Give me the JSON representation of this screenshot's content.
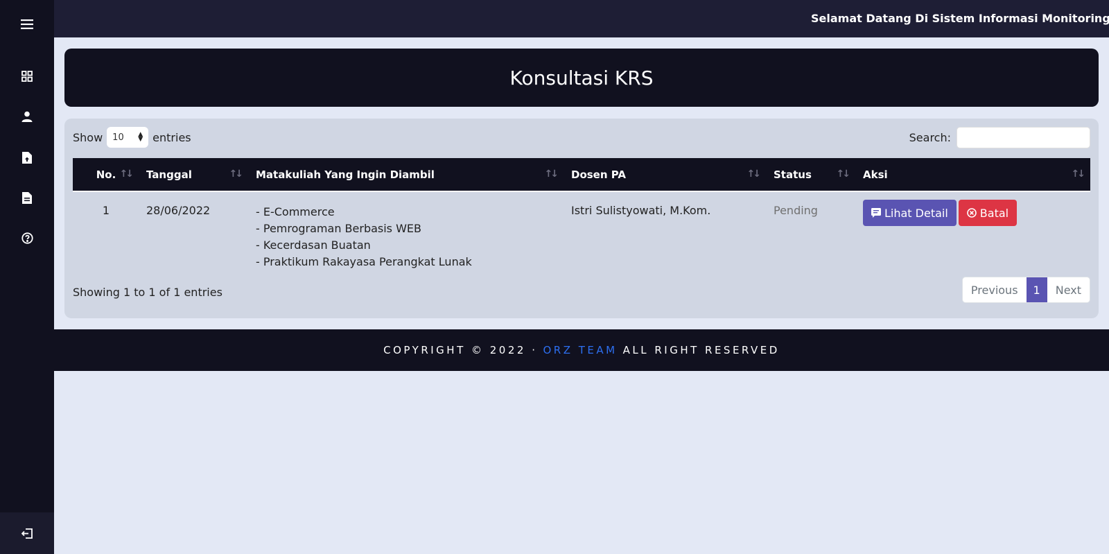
{
  "topbar": {
    "welcome_text": "Selamat Datang Di Sistem Informasi Monitoring Kor"
  },
  "sidebar": {
    "icons": [
      "menu-icon",
      "dashboard-icon",
      "user-icon",
      "document-upload-icon",
      "document-icon",
      "help-icon"
    ],
    "logout_icon": "logout-icon"
  },
  "page": {
    "title": "Konsultasi KRS"
  },
  "table_controls": {
    "show_label": "Show",
    "entries_value": "10",
    "entries_label": "entries",
    "search_label": "Search:",
    "search_value": ""
  },
  "table": {
    "headers": [
      "No.",
      "Tanggal",
      "Matakuliah Yang Ingin Diambil",
      "Dosen PA",
      "Status",
      "Aksi"
    ],
    "rows": [
      {
        "no": "1",
        "tanggal": "28/06/2022",
        "matakuliah": [
          "- E-Commerce",
          "- Pemrograman Berbasis WEB",
          "- Kecerdasan Buatan",
          "- Praktikum Rakayasa Perangkat Lunak"
        ],
        "dosen": "Istri Sulistyowati, M.Kom.",
        "status": "Pending",
        "actions": {
          "detail_label": "Lihat Detail",
          "cancel_label": "Batal"
        }
      }
    ]
  },
  "pagination": {
    "info": "Showing 1 to 1 of 1 entries",
    "previous": "Previous",
    "current": "1",
    "next": "Next"
  },
  "footer": {
    "prefix": "COPYRIGHT © 2022 ·",
    "brand": "ORZ TEAM",
    "suffix": "ALL RIGHT RESERVED"
  },
  "colors": {
    "sidebar_bg": "#11111f",
    "accent_purple": "#5a54b2",
    "danger_red": "#dd3544",
    "brand_blue": "#2d6ff0",
    "page_bg": "#e3e8f5"
  }
}
